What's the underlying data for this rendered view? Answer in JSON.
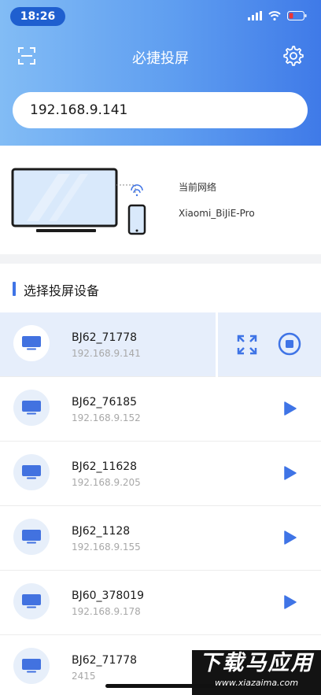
{
  "status_bar": {
    "time": "18:26"
  },
  "nav": {
    "title": "必捷投屏"
  },
  "ip_input": {
    "value": "192.168.9.141"
  },
  "network": {
    "label": "当前网络",
    "name": "Xiaomi_BiJiE-Pro"
  },
  "section": {
    "title": "选择投屏设备"
  },
  "devices": [
    {
      "name": "BJ62_71778",
      "ip": "192.168.9.141",
      "selected": true
    },
    {
      "name": "BJ62_76185",
      "ip": "192.168.9.152",
      "selected": false
    },
    {
      "name": "BJ62_11628",
      "ip": "192.168.9.205",
      "selected": false
    },
    {
      "name": "BJ62_1128",
      "ip": "192.168.9.155",
      "selected": false
    },
    {
      "name": "BJ60_378019",
      "ip": "192.168.9.178",
      "selected": false
    },
    {
      "name": "BJ62_71778",
      "ip": "2415",
      "selected": false
    }
  ],
  "watermark": {
    "main": "下载马应用",
    "sub": "www.xiazaima.com"
  },
  "colors": {
    "header_start": "#82bcf5",
    "header_end": "#3f7ae8",
    "accent": "#3f74e6",
    "selected_row": "#e6eefb"
  },
  "icons": [
    "scan-icon",
    "gear-icon",
    "tv-icon",
    "play-icon",
    "fullscreen-icon",
    "stop-icon",
    "wifi-icon",
    "battery-icon"
  ]
}
